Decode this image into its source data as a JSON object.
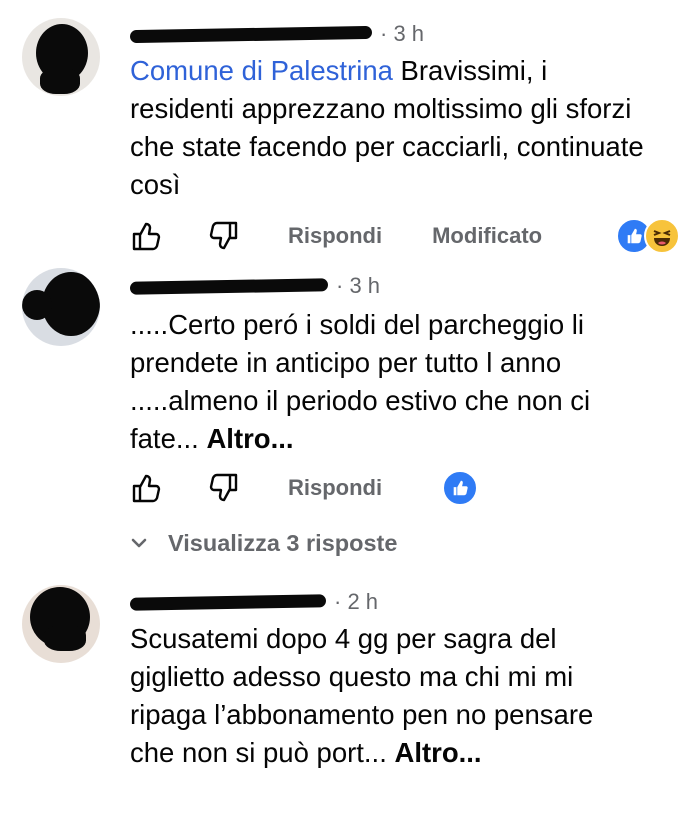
{
  "comments": [
    {
      "time": "3 h",
      "mention": "Comune di Palestrina",
      "text": " Bravissimi, i residenti apprezzano moltissimo gli sforzi che state facendo per cacciarli, continuate così",
      "reply_label": "Rispondi",
      "edited_label": "Modificato",
      "reactions": [
        "like-reaction",
        "haha-reaction"
      ]
    },
    {
      "time": "3 h",
      "text": ".....Certo peró i soldi del parcheggio li prendete in anticipo per tutto l anno .....almeno il periodo estivo che non ci fate... ",
      "more_label": "Altro...",
      "reply_label": "Rispondi",
      "reactions": [
        "like-reaction"
      ],
      "replies_label": "Visualizza 3 risposte"
    },
    {
      "time": "2 h",
      "text": "Scusatemi dopo 4 gg per sagra del giglietto adesso questo ma chi mi mi ripaga l’abbonamento pen no pensare che non si può port... ",
      "more_label": "Altro..."
    }
  ],
  "meta_separator": "·",
  "colors": {
    "link": "#2f62d8",
    "secondary_text": "#65676b",
    "like_blue": "#2f7bf5",
    "haha_yellow": "#f7c33b"
  }
}
